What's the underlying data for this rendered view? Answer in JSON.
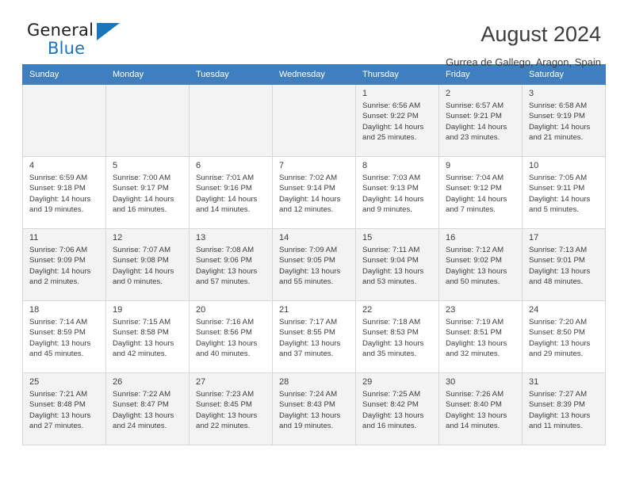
{
  "brand": {
    "name_part1": "General",
    "name_part2": "Blue",
    "logo_icon": "triangle-flag-icon",
    "accent_color": "#1b75bb"
  },
  "header": {
    "title": "August 2024",
    "location": "Gurrea de Gallego, Aragon, Spain"
  },
  "calendar": {
    "header_bg": "#3f7fbf",
    "weekdays": [
      "Sunday",
      "Monday",
      "Tuesday",
      "Wednesday",
      "Thursday",
      "Friday",
      "Saturday"
    ],
    "weeks": [
      [
        {
          "day": "",
          "lines": []
        },
        {
          "day": "",
          "lines": []
        },
        {
          "day": "",
          "lines": []
        },
        {
          "day": "",
          "lines": []
        },
        {
          "day": "1",
          "lines": [
            "Sunrise: 6:56 AM",
            "Sunset: 9:22 PM",
            "Daylight: 14 hours",
            "and 25 minutes."
          ]
        },
        {
          "day": "2",
          "lines": [
            "Sunrise: 6:57 AM",
            "Sunset: 9:21 PM",
            "Daylight: 14 hours",
            "and 23 minutes."
          ]
        },
        {
          "day": "3",
          "lines": [
            "Sunrise: 6:58 AM",
            "Sunset: 9:19 PM",
            "Daylight: 14 hours",
            "and 21 minutes."
          ]
        }
      ],
      [
        {
          "day": "4",
          "lines": [
            "Sunrise: 6:59 AM",
            "Sunset: 9:18 PM",
            "Daylight: 14 hours",
            "and 19 minutes."
          ]
        },
        {
          "day": "5",
          "lines": [
            "Sunrise: 7:00 AM",
            "Sunset: 9:17 PM",
            "Daylight: 14 hours",
            "and 16 minutes."
          ]
        },
        {
          "day": "6",
          "lines": [
            "Sunrise: 7:01 AM",
            "Sunset: 9:16 PM",
            "Daylight: 14 hours",
            "and 14 minutes."
          ]
        },
        {
          "day": "7",
          "lines": [
            "Sunrise: 7:02 AM",
            "Sunset: 9:14 PM",
            "Daylight: 14 hours",
            "and 12 minutes."
          ]
        },
        {
          "day": "8",
          "lines": [
            "Sunrise: 7:03 AM",
            "Sunset: 9:13 PM",
            "Daylight: 14 hours",
            "and 9 minutes."
          ]
        },
        {
          "day": "9",
          "lines": [
            "Sunrise: 7:04 AM",
            "Sunset: 9:12 PM",
            "Daylight: 14 hours",
            "and 7 minutes."
          ]
        },
        {
          "day": "10",
          "lines": [
            "Sunrise: 7:05 AM",
            "Sunset: 9:11 PM",
            "Daylight: 14 hours",
            "and 5 minutes."
          ]
        }
      ],
      [
        {
          "day": "11",
          "lines": [
            "Sunrise: 7:06 AM",
            "Sunset: 9:09 PM",
            "Daylight: 14 hours",
            "and 2 minutes."
          ]
        },
        {
          "day": "12",
          "lines": [
            "Sunrise: 7:07 AM",
            "Sunset: 9:08 PM",
            "Daylight: 14 hours",
            "and 0 minutes."
          ]
        },
        {
          "day": "13",
          "lines": [
            "Sunrise: 7:08 AM",
            "Sunset: 9:06 PM",
            "Daylight: 13 hours",
            "and 57 minutes."
          ]
        },
        {
          "day": "14",
          "lines": [
            "Sunrise: 7:09 AM",
            "Sunset: 9:05 PM",
            "Daylight: 13 hours",
            "and 55 minutes."
          ]
        },
        {
          "day": "15",
          "lines": [
            "Sunrise: 7:11 AM",
            "Sunset: 9:04 PM",
            "Daylight: 13 hours",
            "and 53 minutes."
          ]
        },
        {
          "day": "16",
          "lines": [
            "Sunrise: 7:12 AM",
            "Sunset: 9:02 PM",
            "Daylight: 13 hours",
            "and 50 minutes."
          ]
        },
        {
          "day": "17",
          "lines": [
            "Sunrise: 7:13 AM",
            "Sunset: 9:01 PM",
            "Daylight: 13 hours",
            "and 48 minutes."
          ]
        }
      ],
      [
        {
          "day": "18",
          "lines": [
            "Sunrise: 7:14 AM",
            "Sunset: 8:59 PM",
            "Daylight: 13 hours",
            "and 45 minutes."
          ]
        },
        {
          "day": "19",
          "lines": [
            "Sunrise: 7:15 AM",
            "Sunset: 8:58 PM",
            "Daylight: 13 hours",
            "and 42 minutes."
          ]
        },
        {
          "day": "20",
          "lines": [
            "Sunrise: 7:16 AM",
            "Sunset: 8:56 PM",
            "Daylight: 13 hours",
            "and 40 minutes."
          ]
        },
        {
          "day": "21",
          "lines": [
            "Sunrise: 7:17 AM",
            "Sunset: 8:55 PM",
            "Daylight: 13 hours",
            "and 37 minutes."
          ]
        },
        {
          "day": "22",
          "lines": [
            "Sunrise: 7:18 AM",
            "Sunset: 8:53 PM",
            "Daylight: 13 hours",
            "and 35 minutes."
          ]
        },
        {
          "day": "23",
          "lines": [
            "Sunrise: 7:19 AM",
            "Sunset: 8:51 PM",
            "Daylight: 13 hours",
            "and 32 minutes."
          ]
        },
        {
          "day": "24",
          "lines": [
            "Sunrise: 7:20 AM",
            "Sunset: 8:50 PM",
            "Daylight: 13 hours",
            "and 29 minutes."
          ]
        }
      ],
      [
        {
          "day": "25",
          "lines": [
            "Sunrise: 7:21 AM",
            "Sunset: 8:48 PM",
            "Daylight: 13 hours",
            "and 27 minutes."
          ]
        },
        {
          "day": "26",
          "lines": [
            "Sunrise: 7:22 AM",
            "Sunset: 8:47 PM",
            "Daylight: 13 hours",
            "and 24 minutes."
          ]
        },
        {
          "day": "27",
          "lines": [
            "Sunrise: 7:23 AM",
            "Sunset: 8:45 PM",
            "Daylight: 13 hours",
            "and 22 minutes."
          ]
        },
        {
          "day": "28",
          "lines": [
            "Sunrise: 7:24 AM",
            "Sunset: 8:43 PM",
            "Daylight: 13 hours",
            "and 19 minutes."
          ]
        },
        {
          "day": "29",
          "lines": [
            "Sunrise: 7:25 AM",
            "Sunset: 8:42 PM",
            "Daylight: 13 hours",
            "and 16 minutes."
          ]
        },
        {
          "day": "30",
          "lines": [
            "Sunrise: 7:26 AM",
            "Sunset: 8:40 PM",
            "Daylight: 13 hours",
            "and 14 minutes."
          ]
        },
        {
          "day": "31",
          "lines": [
            "Sunrise: 7:27 AM",
            "Sunset: 8:39 PM",
            "Daylight: 13 hours",
            "and 11 minutes."
          ]
        }
      ]
    ]
  }
}
